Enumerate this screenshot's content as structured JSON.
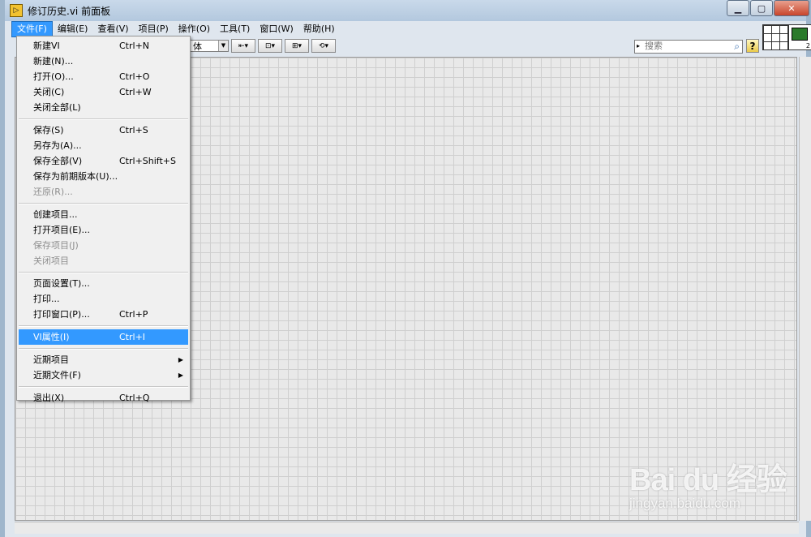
{
  "window": {
    "title": "修订历史.vi 前面板",
    "app_icon_glyph": "▷",
    "controls": [
      "▁",
      "▢",
      "✕"
    ]
  },
  "menubar": {
    "items": [
      "文件(F)",
      "编辑(E)",
      "查看(V)",
      "项目(P)",
      "操作(O)",
      "工具(T)",
      "窗口(W)",
      "帮助(H)"
    ],
    "active_index": 0
  },
  "toolbar": {
    "font_label": "体",
    "font_arrow": "▼",
    "align_btn": "⇤▾",
    "distribute_btn": "⊡▾",
    "resize_btn": "⊞▾",
    "reorder_btn": "⟲▾",
    "search": {
      "placeholder": "搜索",
      "lead_glyph": "▸",
      "icon": "magnifier-icon",
      "icon_glyph": "⌕"
    },
    "help_glyph": "?",
    "vi_icon_number": "2"
  },
  "file_menu": {
    "groups": [
      [
        {
          "label": "新建VI",
          "shortcut": "Ctrl+N"
        },
        {
          "label": "新建(N)...",
          "shortcut": ""
        },
        {
          "label": "打开(O)...",
          "shortcut": "Ctrl+O"
        },
        {
          "label": "关闭(C)",
          "shortcut": "Ctrl+W"
        },
        {
          "label": "关闭全部(L)",
          "shortcut": ""
        }
      ],
      [
        {
          "label": "保存(S)",
          "shortcut": "Ctrl+S"
        },
        {
          "label": "另存为(A)...",
          "shortcut": ""
        },
        {
          "label": "保存全部(V)",
          "shortcut": "Ctrl+Shift+S"
        },
        {
          "label": "保存为前期版本(U)...",
          "shortcut": ""
        },
        {
          "label": "还原(R)...",
          "shortcut": "",
          "disabled": true
        }
      ],
      [
        {
          "label": "创建项目...",
          "shortcut": ""
        },
        {
          "label": "打开项目(E)...",
          "shortcut": ""
        },
        {
          "label": "保存项目(J)",
          "shortcut": "",
          "disabled": true
        },
        {
          "label": "关闭项目",
          "shortcut": "",
          "disabled": true
        }
      ],
      [
        {
          "label": "页面设置(T)...",
          "shortcut": ""
        },
        {
          "label": "打印...",
          "shortcut": ""
        },
        {
          "label": "打印窗口(P)...",
          "shortcut": "Ctrl+P"
        }
      ],
      [
        {
          "label": "VI属性(I)",
          "shortcut": "Ctrl+I",
          "highlighted": true
        }
      ],
      [
        {
          "label": "近期项目",
          "shortcut": "",
          "submenu": true
        },
        {
          "label": "近期文件(F)",
          "shortcut": "",
          "submenu": true
        }
      ],
      [
        {
          "label": "退出(X)",
          "shortcut": "Ctrl+Q"
        }
      ]
    ],
    "submenu_glyph": "▶"
  },
  "watermark": {
    "brand": "Bai du 经验",
    "url": "jingyan.baidu.com"
  },
  "colors": {
    "highlight": "#3399ff",
    "canvas_bg": "#e9e9e9",
    "grid": "#cfcfcf"
  }
}
